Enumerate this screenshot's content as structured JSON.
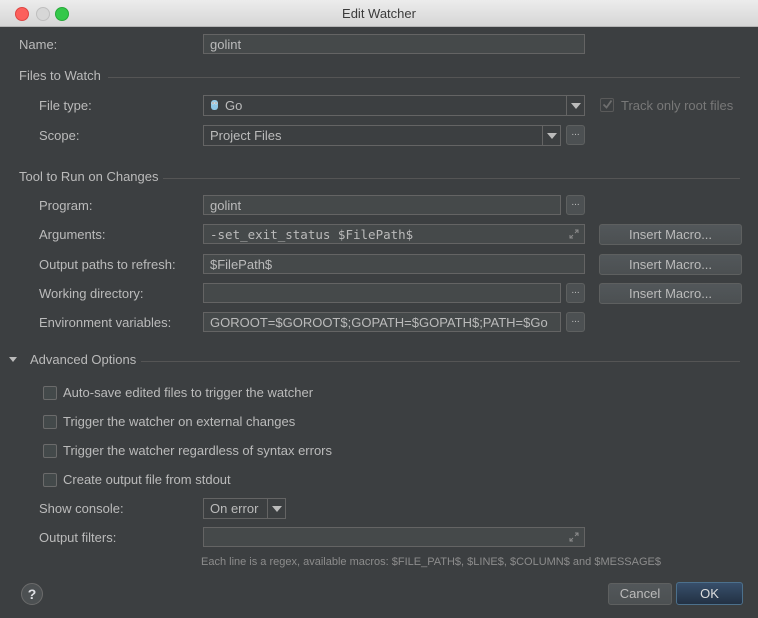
{
  "window": {
    "title": "Edit Watcher"
  },
  "name": {
    "label": "Name:",
    "value": "golint"
  },
  "files_to_watch": {
    "heading": "Files to Watch",
    "file_type": {
      "label": "File type:",
      "value": "Go",
      "icon": "go-gopher-icon"
    },
    "track_only_root": {
      "label": "Track only root files",
      "checked": true,
      "disabled": true
    },
    "scope": {
      "label": "Scope:",
      "value": "Project Files"
    }
  },
  "tool": {
    "heading": "Tool to Run on Changes",
    "program": {
      "label": "Program:",
      "value": "golint"
    },
    "arguments": {
      "label": "Arguments:",
      "value": "-set_exit_status $FilePath$"
    },
    "output_paths": {
      "label": "Output paths to refresh:",
      "value": "$FilePath$"
    },
    "working_dir": {
      "label": "Working directory:",
      "value": ""
    },
    "env_vars": {
      "label": "Environment variables:",
      "value": "GOROOT=$GOROOT$;GOPATH=$GOPATH$;PATH=$Go"
    },
    "insert_macro_label": "Insert Macro...",
    "browse_label": "..."
  },
  "advanced": {
    "heading": "Advanced Options",
    "options": [
      {
        "label": "Auto-save edited files to trigger the watcher",
        "checked": false
      },
      {
        "label": "Trigger the watcher on external changes",
        "checked": false
      },
      {
        "label": "Trigger the watcher regardless of syntax errors",
        "checked": false
      },
      {
        "label": "Create output file from stdout",
        "checked": false
      }
    ],
    "show_console": {
      "label": "Show console:",
      "value": "On error"
    },
    "output_filters": {
      "label": "Output filters:",
      "value": ""
    },
    "hint": "Each line is a regex, available macros: $FILE_PATH$, $LINE$, $COLUMN$ and $MESSAGE$"
  },
  "footer": {
    "help_label": "?",
    "cancel_label": "Cancel",
    "ok_label": "OK"
  },
  "colors": {
    "background": "#3c3f41",
    "field": "#45494a",
    "accent": "#4c708c"
  }
}
